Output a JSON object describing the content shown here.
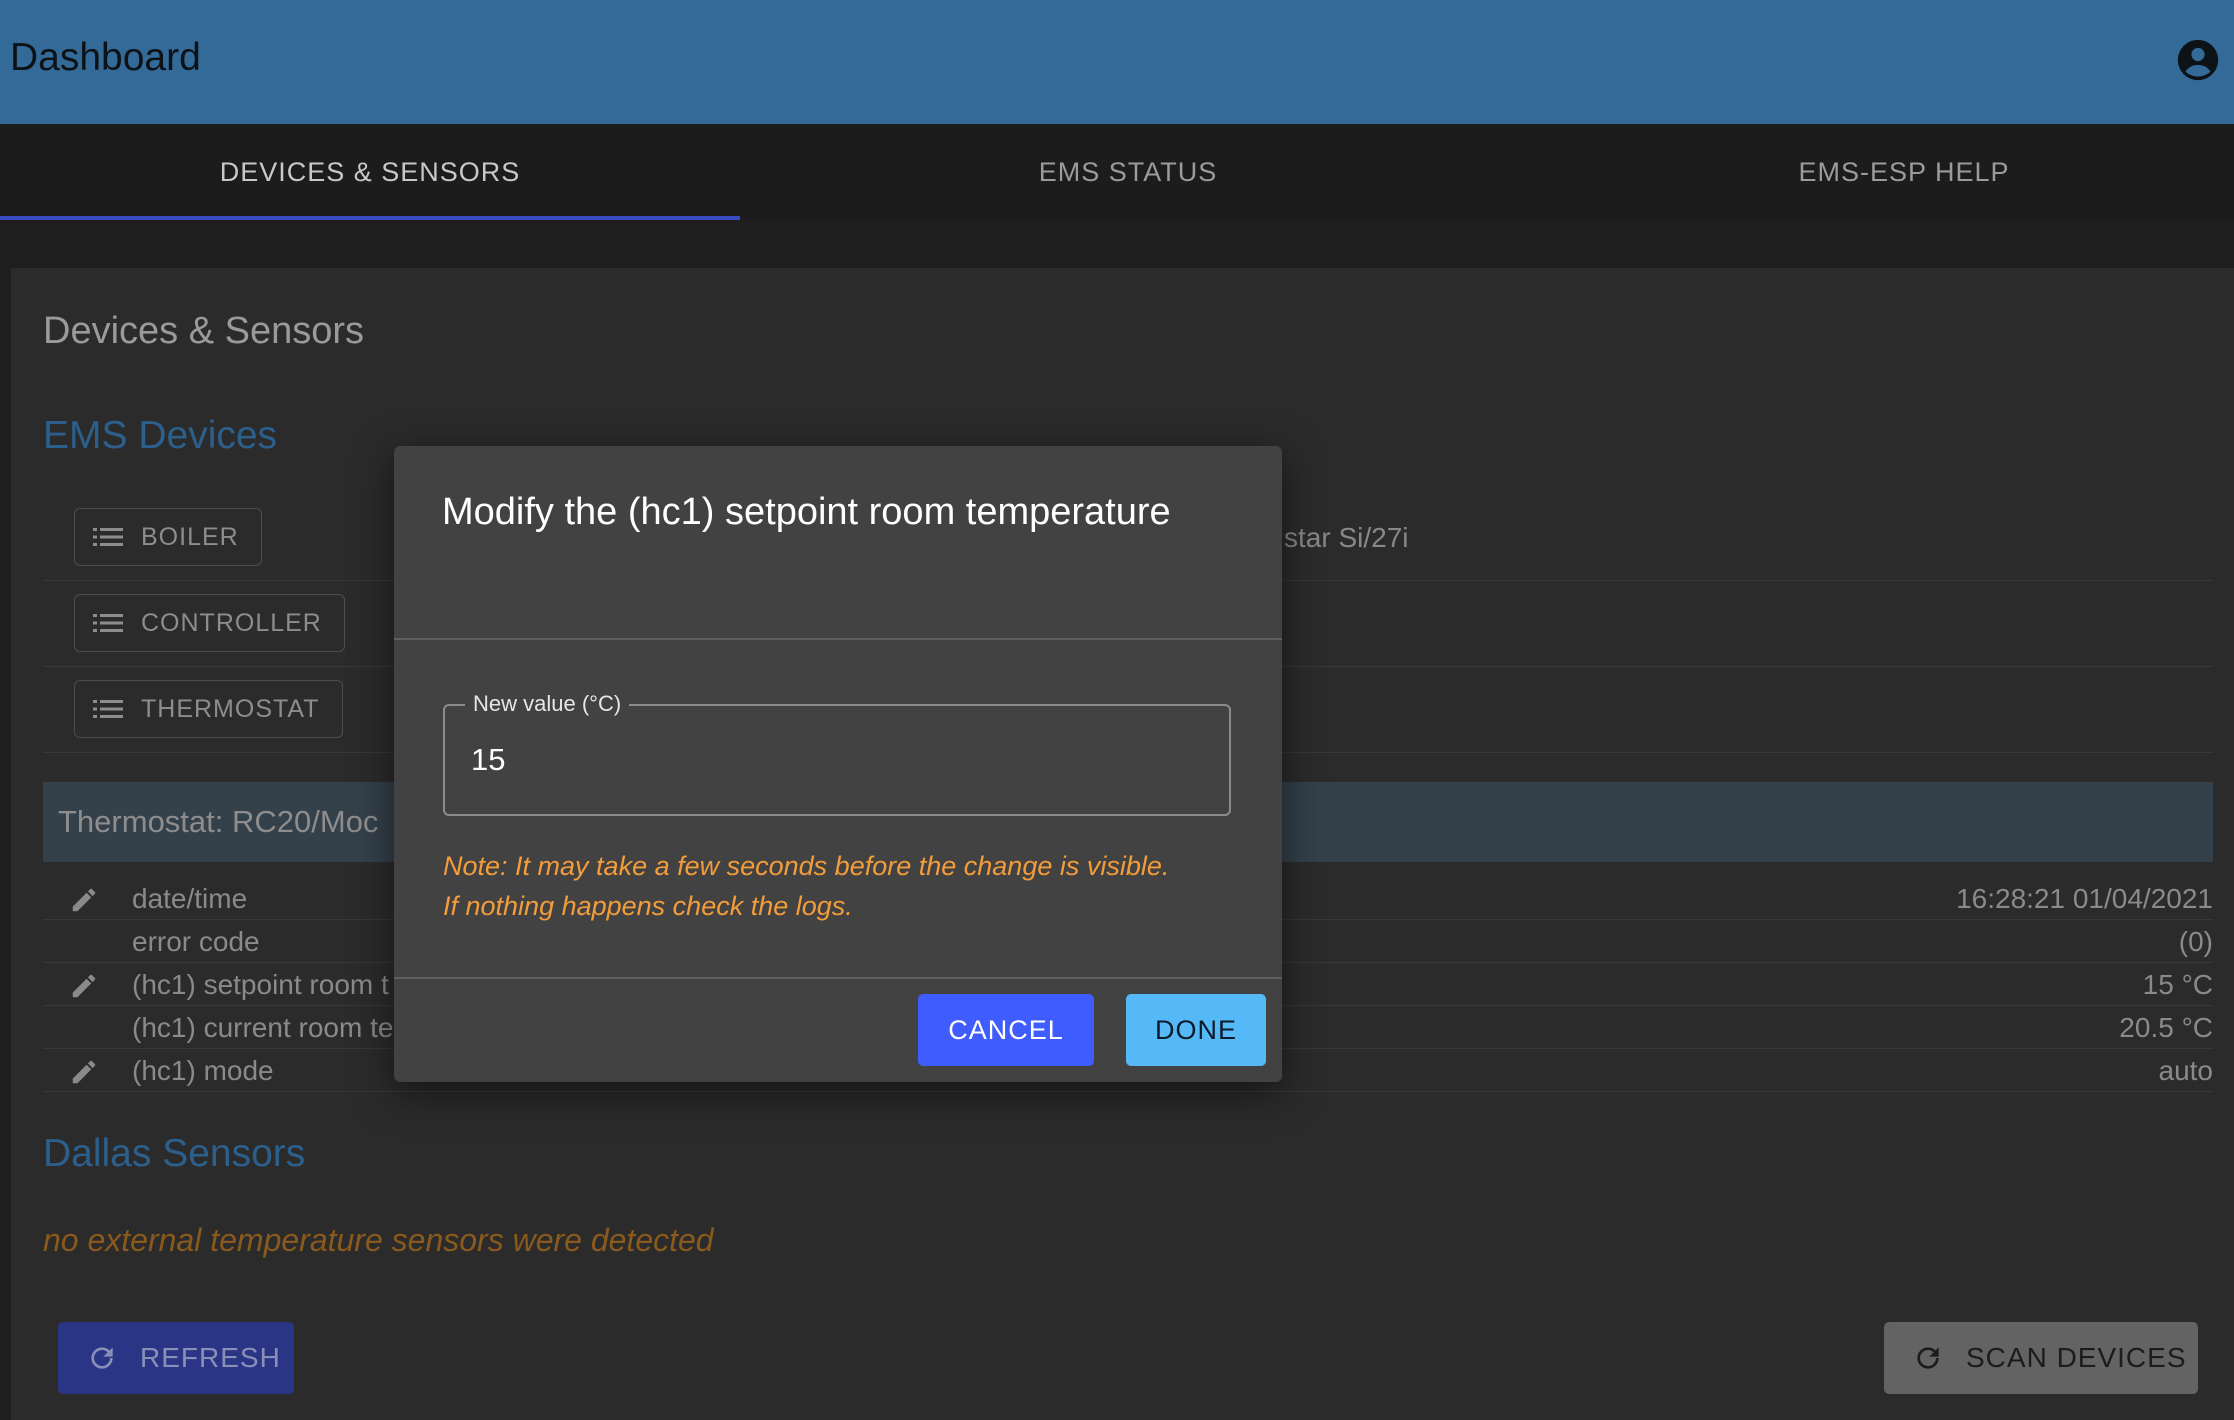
{
  "appbar": {
    "title": "Dashboard",
    "account_icon": "account-circle-icon"
  },
  "tabs": [
    {
      "label": "DEVICES & SENSORS",
      "active": true
    },
    {
      "label": "EMS STATUS",
      "active": false
    },
    {
      "label": "EMS-ESP HELP",
      "active": false
    }
  ],
  "panel": {
    "title": "Devices & Sensors",
    "ems_heading": "EMS Devices",
    "devices": [
      {
        "label": "BOILER",
        "icon": "list-icon"
      },
      {
        "label": "CONTROLLER",
        "icon": "list-icon"
      },
      {
        "label": "THERMOSTAT",
        "icon": "list-icon"
      }
    ],
    "boiler_desc_partial": "star Si/27i",
    "thermostat_header": "Thermostat: RC20/Moc",
    "rows": [
      {
        "label": "date/time",
        "value": "16:28:21 01/04/2021",
        "editable": true
      },
      {
        "label": "error code",
        "value": "(0)",
        "editable": false
      },
      {
        "label": "(hc1) setpoint room t",
        "value": "15 °C",
        "editable": true
      },
      {
        "label": "(hc1) current room te",
        "value": "20.5 °C",
        "editable": false
      },
      {
        "label": "(hc1) mode",
        "value": "auto",
        "editable": true
      }
    ],
    "dallas_heading": "Dallas Sensors",
    "no_sensors": "no external temperature sensors were detected",
    "refresh_label": "REFRESH",
    "scan_label": "SCAN DEVICES"
  },
  "dialog": {
    "title": "Modify the (hc1) setpoint room temperature",
    "field_label": "New value (°C)",
    "field_value": "15",
    "note_line1": "Note: It may take a few seconds before the change is visible.",
    "note_line2": "If nothing happens check the logs.",
    "cancel_label": "CANCEL",
    "done_label": "DONE"
  },
  "colors": {
    "appbar": "#346a98",
    "tab_indicator": "#3a4bc6",
    "cancel": "#3f5cff",
    "done": "#55b8f7",
    "note": "#f39c3a",
    "section_heading": "#2c5f8c"
  }
}
